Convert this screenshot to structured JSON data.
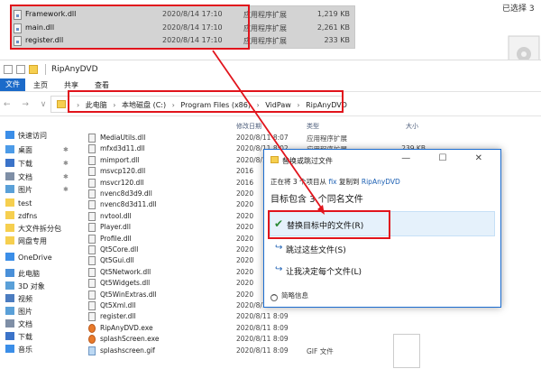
{
  "top_files": [
    {
      "name": "Framework.dll",
      "date": "2020/8/14 17:10",
      "type": "应用程序扩展",
      "size": "1,219 KB"
    },
    {
      "name": "main.dll",
      "date": "2020/8/14 17:10",
      "type": "应用程序扩展",
      "size": "2,261 KB"
    },
    {
      "name": "register.dll",
      "date": "2020/8/14 17:10",
      "type": "应用程序扩展",
      "size": "233 KB"
    }
  ],
  "selection_status": "已选择 3",
  "window": {
    "title": "RipAnyDVD",
    "ribbon_tabs": [
      "文件",
      "主页",
      "共享",
      "查看"
    ],
    "nav_arrows": "← → ∨ ↑",
    "breadcrumb": [
      "此电脑",
      "本地磁盘 (C:)",
      "Program Files (x86)",
      "VidPaw",
      "RipAnyDVD"
    ],
    "breadcrumb_sep": "›",
    "column_header_date": "修改日期",
    "column_header_type": "类型",
    "column_header_size": "大小"
  },
  "sidebar": {
    "items": [
      {
        "label": "快速访问",
        "color": "#3b8ee8",
        "pinned": false
      },
      {
        "label": "桌面",
        "color": "#4c9be8",
        "pinned": true
      },
      {
        "label": "下载",
        "color": "#3b73c9",
        "pinned": true
      },
      {
        "label": "文档",
        "color": "#7f8fa6",
        "pinned": true
      },
      {
        "label": "图片",
        "color": "#5aa0d8",
        "pinned": true
      },
      {
        "label": "test",
        "color": "#f6cf4f",
        "pinned": false
      },
      {
        "label": "zdfns",
        "color": "#f6cf4f",
        "pinned": false
      },
      {
        "label": "大文件拆分包",
        "color": "#f6cf4f",
        "pinned": false
      },
      {
        "label": "网盘专用",
        "color": "#f6cf4f",
        "pinned": false
      },
      {
        "label": "OneDrive",
        "color": "#3b8ee8",
        "pinned": false
      },
      {
        "label": "此电脑",
        "color": "#4a90d9",
        "pinned": false
      },
      {
        "label": "3D 对象",
        "color": "#5aa0d8",
        "pinned": false
      },
      {
        "label": "视频",
        "color": "#4c7cc0",
        "pinned": false
      },
      {
        "label": "图片",
        "color": "#5aa0d8",
        "pinned": false
      },
      {
        "label": "文档",
        "color": "#7f8fa6",
        "pinned": false
      },
      {
        "label": "下载",
        "color": "#3b73c9",
        "pinned": false
      },
      {
        "label": "音乐",
        "color": "#3b8ee8",
        "pinned": false
      }
    ]
  },
  "files": [
    {
      "name": "MediaUtils.dll",
      "date": "2020/8/11 8:07",
      "type": "应用程序扩展",
      "size": "",
      "kind": "dll"
    },
    {
      "name": "mfxd3d11.dll",
      "date": "2020/8/11 8:02",
      "type": "应用程序扩展",
      "size": "239 KB",
      "kind": "dll"
    },
    {
      "name": "mimport.dll",
      "date": "2020/8/11",
      "type": "",
      "size": "",
      "kind": "dll"
    },
    {
      "name": "msvcp120.dll",
      "date": "2016",
      "type": "",
      "size": "",
      "kind": "dll"
    },
    {
      "name": "msvcr120.dll",
      "date": "2016",
      "type": "",
      "size": "",
      "kind": "dll"
    },
    {
      "name": "nvenc8d3d9.dll",
      "date": "2020",
      "type": "",
      "size": "",
      "kind": "dll"
    },
    {
      "name": "nvenc8d3d11.dll",
      "date": "2020",
      "type": "",
      "size": "",
      "kind": "dll"
    },
    {
      "name": "nvtool.dll",
      "date": "2020",
      "type": "",
      "size": "",
      "kind": "dll"
    },
    {
      "name": "Player.dll",
      "date": "2020",
      "type": "",
      "size": "",
      "kind": "dll"
    },
    {
      "name": "Profile.dll",
      "date": "2020",
      "type": "",
      "size": "",
      "kind": "dll"
    },
    {
      "name": "Qt5Core.dll",
      "date": "2020",
      "type": "",
      "size": "",
      "kind": "dll"
    },
    {
      "name": "Qt5Gui.dll",
      "date": "2020",
      "type": "",
      "size": "",
      "kind": "dll"
    },
    {
      "name": "Qt5Network.dll",
      "date": "2020",
      "type": "",
      "size": "",
      "kind": "dll"
    },
    {
      "name": "Qt5Widgets.dll",
      "date": "2020",
      "type": "",
      "size": "",
      "kind": "dll"
    },
    {
      "name": "Qt5WinExtras.dll",
      "date": "2020",
      "type": "",
      "size": "",
      "kind": "dll"
    },
    {
      "name": "Qt5Xml.dll",
      "date": "2020/8/11 8:09",
      "type": "",
      "size": "",
      "kind": "dll"
    },
    {
      "name": "register.dll",
      "date": "2020/8/11 8:09",
      "type": "",
      "size": "",
      "kind": "dll"
    },
    {
      "name": "RipAnyDVD.exe",
      "date": "2020/8/11 8:09",
      "type": "",
      "size": "",
      "kind": "exe"
    },
    {
      "name": "splashScreen.exe",
      "date": "2020/8/11 8:09",
      "type": "",
      "size": "",
      "kind": "exe"
    },
    {
      "name": "splashscreen.gif",
      "date": "2020/8/11 8:09",
      "type": "GIF 文件",
      "size": "",
      "kind": "gif"
    }
  ],
  "dialog": {
    "title": "替换或跳过文件",
    "progress_prefix": "正在将 3 个项目从",
    "progress_from": "fix",
    "progress_mid": "复制到",
    "progress_to": "RipAnyDVD",
    "heading": "目标包含 3 个同名文件",
    "options": [
      {
        "label": "替换目标中的文件(R)",
        "icon": "check"
      },
      {
        "label": "跳过这些文件(S)",
        "icon": "arrow"
      },
      {
        "label": "让我决定每个文件(L)",
        "icon": "arrow"
      }
    ],
    "details": "简略信息",
    "window_buttons": "— ☐ ✕"
  },
  "colors": {
    "annotation_red": "#e1141c",
    "selection_gray": "#d3d3d3",
    "accent_blue": "#1b6ac9",
    "check_green": "#2a8a35"
  }
}
